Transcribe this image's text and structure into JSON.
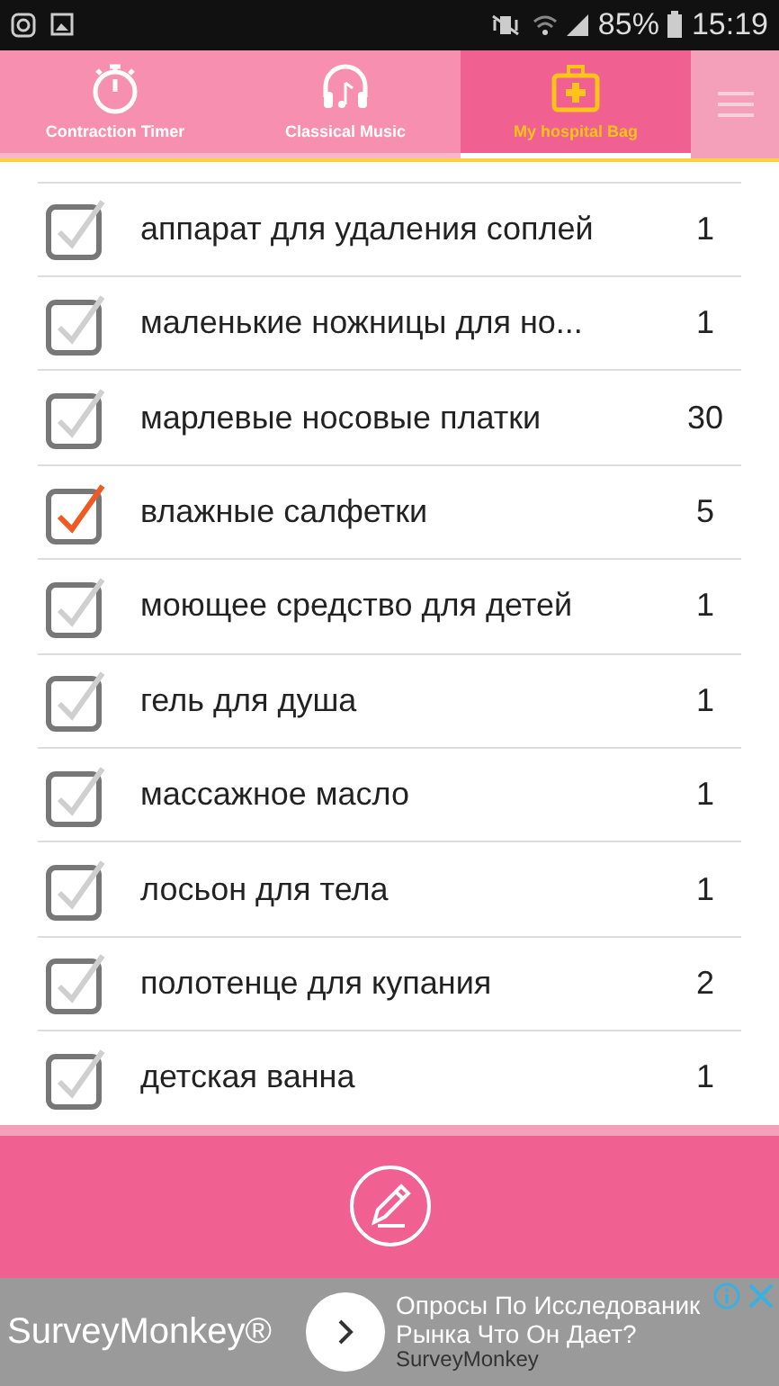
{
  "status_bar": {
    "battery": "85%",
    "time": "15:19"
  },
  "tabs": [
    {
      "label": "Contraction Timer",
      "kind": "timer",
      "selected": false
    },
    {
      "label": "Classical Music",
      "kind": "music",
      "selected": false
    },
    {
      "label": "My hospital Bag",
      "kind": "bag",
      "selected": true
    }
  ],
  "items": [
    {
      "name": "аппарат для удаления соплей",
      "quantity": "1",
      "checked": false
    },
    {
      "name": "маленькие ножницы для но...",
      "quantity": "1",
      "checked": false
    },
    {
      "name": "марлевые носовые платки",
      "quantity": "30",
      "checked": false
    },
    {
      "name": "влажные салфетки",
      "quantity": "5",
      "checked": true
    },
    {
      "name": "моющее средство для детей",
      "quantity": "1",
      "checked": false
    },
    {
      "name": "гель для душа",
      "quantity": "1",
      "checked": false
    },
    {
      "name": "массажное масло",
      "quantity": "1",
      "checked": false
    },
    {
      "name": "лосьон для тела",
      "quantity": "1",
      "checked": false
    },
    {
      "name": "полотенце для купания",
      "quantity": "2",
      "checked": false
    },
    {
      "name": "детская ванна",
      "quantity": "1",
      "checked": false
    }
  ],
  "ad": {
    "brand": "SurveyMonkey®",
    "headline": "Опросы По Исследованик",
    "headline_2": "Рынка Что Он Дает?",
    "advertiser": "SurveyMonkey"
  }
}
